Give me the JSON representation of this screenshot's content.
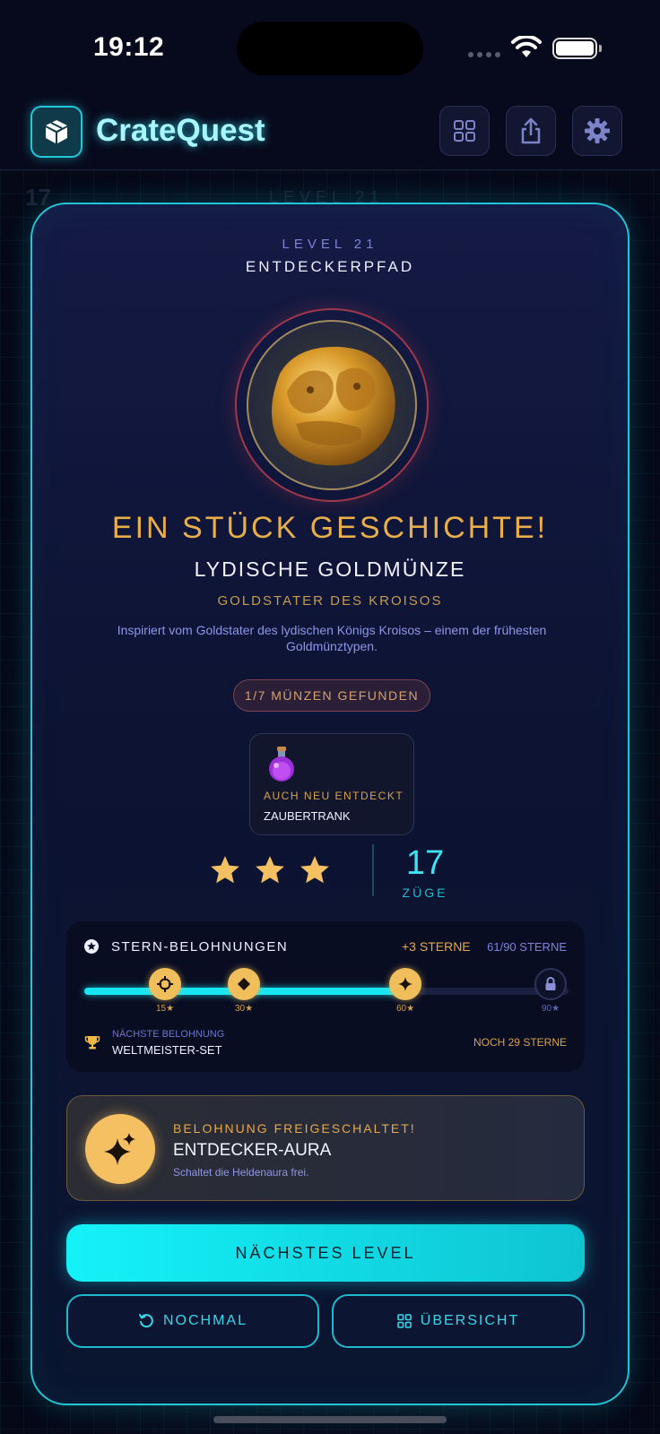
{
  "status_bar": {
    "time": "19:12"
  },
  "app": {
    "title": "CrateQuest"
  },
  "header_buttons": [
    "grid-icon",
    "share-icon",
    "gear-icon"
  ],
  "background": {
    "faint_number": "17",
    "faint_level": "LEVEL 21"
  },
  "card": {
    "level": "LEVEL 21",
    "path": "ENTDECKERPFAD",
    "headline": "EIN STÜCK GESCHICHTE!",
    "item_name": "LYDISCHE GOLDMÜNZE",
    "item_subtitle": "GOLDSTATER DES KROISOS",
    "item_description": "Inspiriert vom Goldstater des lydischen Königs Kroisos – einem der frühesten Goldmünztypen.",
    "found_badge": "1/7 MÜNZEN GEFUNDEN",
    "also_discovered": {
      "label": "AUCH NEU ENTDECKT",
      "name": "ZAUBERTRANK",
      "icon": "potion-icon"
    },
    "stars_earned": 3,
    "stars_max": 3,
    "moves": {
      "value": "17",
      "label": "ZÜGE"
    }
  },
  "star_rewards": {
    "title": "STERN-BELOHNUNGEN",
    "gained": "+3 STERNE",
    "total": "61/90 STERNE",
    "progress": 0.678,
    "milestones": [
      {
        "label": "15★",
        "stars": 15,
        "icon": "target-icon",
        "reached": true
      },
      {
        "label": "30★",
        "stars": 30,
        "icon": "diamond-icon",
        "reached": true
      },
      {
        "label": "60★",
        "stars": 60,
        "icon": "sparkle-icon",
        "reached": true
      },
      {
        "label": "90★",
        "stars": 90,
        "icon": "lock-icon",
        "reached": false
      }
    ],
    "next_reward_label": "NÄCHSTE BELOHNUNG",
    "next_reward_name": "WELTMEISTER-SET",
    "remaining": "NOCH 29 STERNE"
  },
  "unlocked": {
    "label": "BELOHNUNG FREIGESCHALTET!",
    "name": "ENTDECKER-AURA",
    "description": "Schaltet die Heldenaura frei."
  },
  "buttons": {
    "next_level": "NÄCHSTES LEVEL",
    "retry": "NOCHMAL",
    "overview": "ÜBERSICHT"
  },
  "colors": {
    "accent_cyan": "#17e6f2",
    "gold": "#e8ae4a",
    "card_bg": "#0d1332",
    "lavender_text": "#8f95e6"
  }
}
